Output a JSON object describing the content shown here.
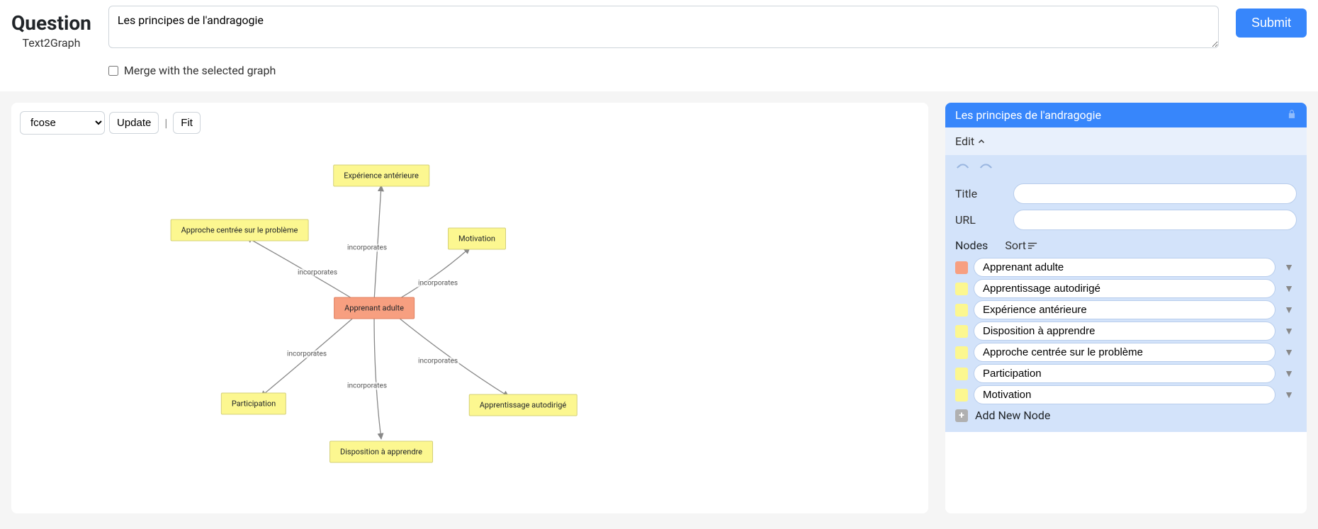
{
  "header": {
    "title": "Question",
    "subtitle": "Text2Graph",
    "question_value": "Les principes de l'andragogie",
    "merge_label": "Merge with the selected graph",
    "submit_label": "Submit"
  },
  "toolbar": {
    "layout_options": [
      "fcose"
    ],
    "layout_selected": "fcose",
    "update_label": "Update",
    "fit_label": "Fit"
  },
  "graph": {
    "center_label": "Apprenant adulte",
    "edge_label": "incorporates",
    "nodes": {
      "experience": "Expérience antérieure",
      "approche": "Approche centrée sur le problème",
      "motivation": "Motivation",
      "participation": "Participation",
      "disposition": "Disposition à apprendre",
      "autodirige": "Apprentissage autodirigé"
    }
  },
  "side": {
    "title": "Les principes de l'andragogie",
    "edit_label": "Edit",
    "title_label": "Title",
    "title_value": "",
    "url_label": "URL",
    "url_value": "",
    "nodes_label": "Nodes",
    "sort_label": "Sort",
    "add_label": "Add New Node",
    "items": [
      {
        "color": "#f79f80",
        "label": "Apprenant adulte"
      },
      {
        "color": "#fcf790",
        "label": "Apprentissage autodirigé"
      },
      {
        "color": "#fcf790",
        "label": "Expérience antérieure"
      },
      {
        "color": "#fcf790",
        "label": "Disposition à apprendre"
      },
      {
        "color": "#fcf790",
        "label": "Approche centrée sur le problème"
      },
      {
        "color": "#fcf790",
        "label": "Participation"
      },
      {
        "color": "#fcf790",
        "label": "Motivation"
      }
    ]
  }
}
